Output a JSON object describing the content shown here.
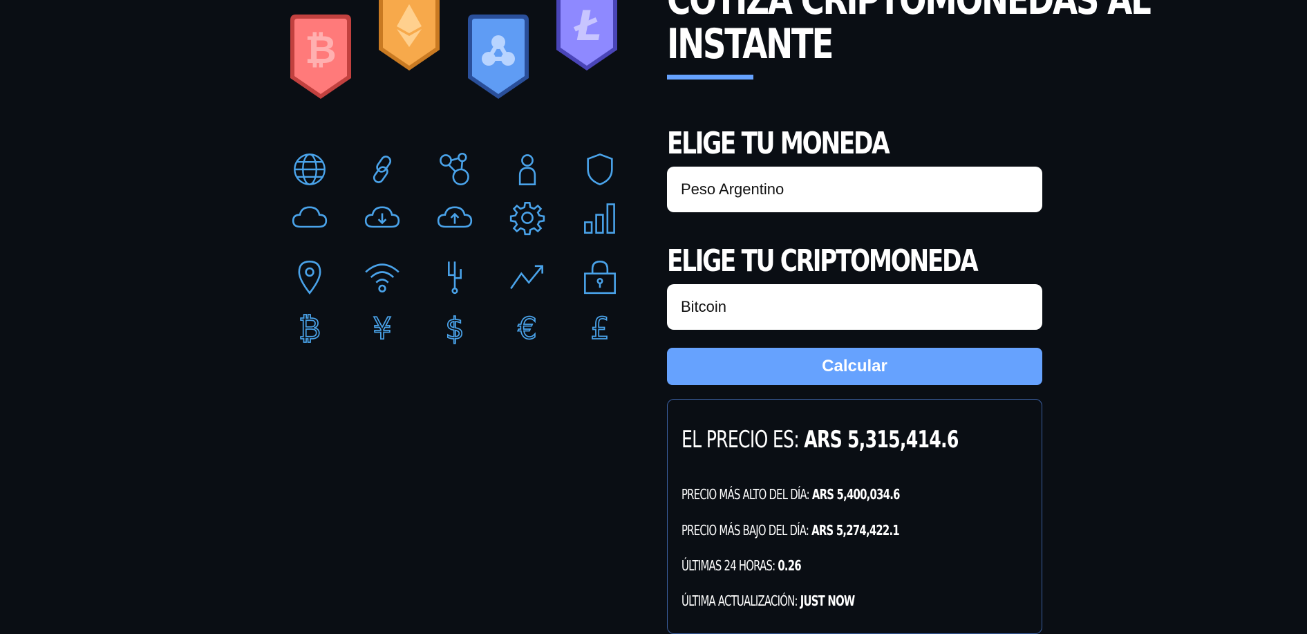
{
  "page": {
    "title_line1": "Cotiza criptomonedas al",
    "title_line2": "instante",
    "accent_color": "#66a2fe",
    "background_color": "#0a0e14"
  },
  "hero": {
    "coins": [
      {
        "name": "bitcoin-badge-icon",
        "color": "#ff7a7a"
      },
      {
        "name": "ethereum-badge-icon",
        "color": "#f7a94b"
      },
      {
        "name": "ripple-badge-icon",
        "color": "#5f9cf4"
      },
      {
        "name": "litecoin-badge-icon",
        "color": "#7c77f2"
      }
    ],
    "icons": [
      "globe-icon",
      "link-icon",
      "nodes-icon",
      "user-icon",
      "shield-icon",
      "cloud-icon",
      "cloud-download-icon",
      "cloud-upload-icon",
      "gear-icon",
      "signal-bars-icon",
      "location-pin-icon",
      "wifi-icon",
      "circuit-icon",
      "trend-up-icon",
      "padlock-icon",
      "bitcoin-symbol-icon",
      "yen-symbol-icon",
      "dollar-symbol-icon",
      "euro-symbol-icon",
      "pound-symbol-icon"
    ]
  },
  "form": {
    "currency_label": "Elige tu Moneda",
    "currency_value": "Peso Argentino",
    "crypto_label": "Elige tu Criptomoneda",
    "crypto_value": "Bitcoin",
    "submit_label": "Calcular"
  },
  "result": {
    "price_label": "El Precio es:",
    "price_value": "ARS 5,315,414.6",
    "high_label": "Precio más alto del día:",
    "high_value": "ARS 5,400,034.6",
    "low_label": "Precio más bajo del día:",
    "low_value": "ARS 5,274,422.1",
    "change_label": "Últimas 24 horas:",
    "change_value": "0.26",
    "updated_label": "Última Actualización:",
    "updated_value": "Just now"
  }
}
